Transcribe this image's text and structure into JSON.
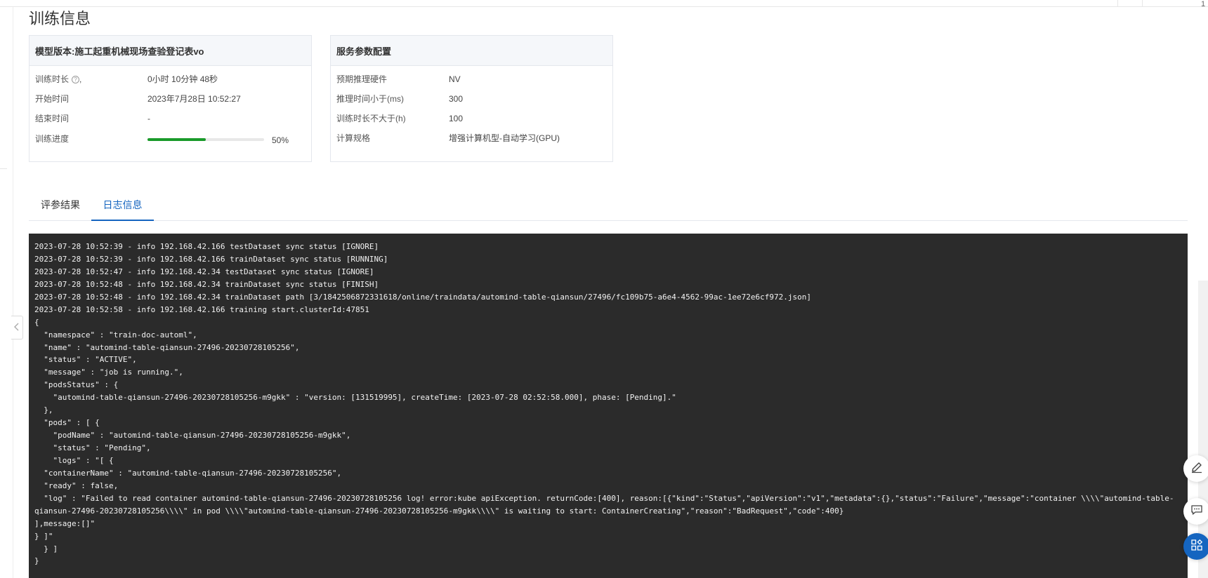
{
  "page": {
    "title": "训练信息"
  },
  "model_card": {
    "header": "模型版本:施工起重机械现场查验登记表vo",
    "rows": [
      {
        "label": "训练时长",
        "value": "0小时 10分钟 48秒",
        "help_suffix": ","
      },
      {
        "label": "开始时间",
        "value": "2023年7月28日 10:52:27"
      },
      {
        "label": "结束时间",
        "value": "-"
      },
      {
        "label": "训练进度",
        "value": "50%"
      }
    ],
    "progress_fraction": 0.5,
    "progress_color": "#1a9a2a"
  },
  "service_card": {
    "header": "服务参数配置",
    "rows": [
      {
        "label": "预期推理硬件",
        "value": "NV"
      },
      {
        "label": "推理时间小于(ms)",
        "value": "300"
      },
      {
        "label": "训练时长不大于(h)",
        "value": "100"
      },
      {
        "label": "计算规格",
        "value": "增强计算机型-自动学习(GPU)"
      }
    ]
  },
  "tabs": [
    {
      "label": "评参结果",
      "active": false
    },
    {
      "label": "日志信息",
      "active": true
    }
  ],
  "accent_color": "#1565c0",
  "log_lines": [
    "2023-07-28 10:52:39 - info 192.168.42.166 testDataset sync status [IGNORE]",
    "2023-07-28 10:52:39 - info 192.168.42.166 trainDataset sync status [RUNNING]",
    "2023-07-28 10:52:47 - info 192.168.42.34 testDataset sync status [IGNORE]",
    "2023-07-28 10:52:48 - info 192.168.42.34 trainDataset sync status [FINISH]",
    "2023-07-28 10:52:48 - info 192.168.42.34 trainDataset path [3/1842506872331618/online/traindata/automind-table-qiansun/27496/fc109b75-a6e4-4562-99ac-1ee72e6cf972.json]",
    "2023-07-28 10:52:58 - info 192.168.42.166 training start.clusterId:47851",
    "{",
    "  \"namespace\" : \"train-doc-automl\",",
    "  \"name\" : \"automind-table-qiansun-27496-20230728105256\",",
    "  \"status\" : \"ACTIVE\",",
    "  \"message\" : \"job is running.\",",
    "  \"podsStatus\" : {",
    "    \"automind-table-qiansun-27496-20230728105256-m9gkk\" : \"version: [131519995], createTime: [2023-07-28 02:52:58.000], phase: [Pending].\"",
    "  },",
    "  \"pods\" : [ {",
    "    \"podName\" : \"automind-table-qiansun-27496-20230728105256-m9gkk\",",
    "    \"status\" : \"Pending\",",
    "    \"logs\" : \"[ {",
    "  \"containerName\" : \"automind-table-qiansun-27496-20230728105256\",",
    "  \"ready\" : false,",
    "  \"log\" : \"Failed to read container automind-table-qiansun-27496-20230728105256 log! error:kube apiException. returnCode:[400], reason:[{\"kind\":\"Status\",\"apiVersion\":\"v1\",\"metadata\":{},\"status\":\"Failure\",\"message\":\"container \\\\\\\\\"automind-table-",
    "qiansun-27496-20230728105256\\\\\\\\\" in pod \\\\\\\\\"automind-table-qiansun-27496-20230728105256-m9gkk\\\\\\\\\" is waiting to start: ContainerCreating\",\"reason\":\"BadRequest\",\"code\":400}",
    "],message:[]\"",
    "} ]\"",
    "  } ]",
    "}"
  ],
  "icons": {
    "collapse": "chevron-left-icon",
    "help": "question-circle-icon",
    "edit": "edit-pen-icon",
    "feedback": "chat-bubble-icon",
    "apps": "apps-grid-icon"
  }
}
